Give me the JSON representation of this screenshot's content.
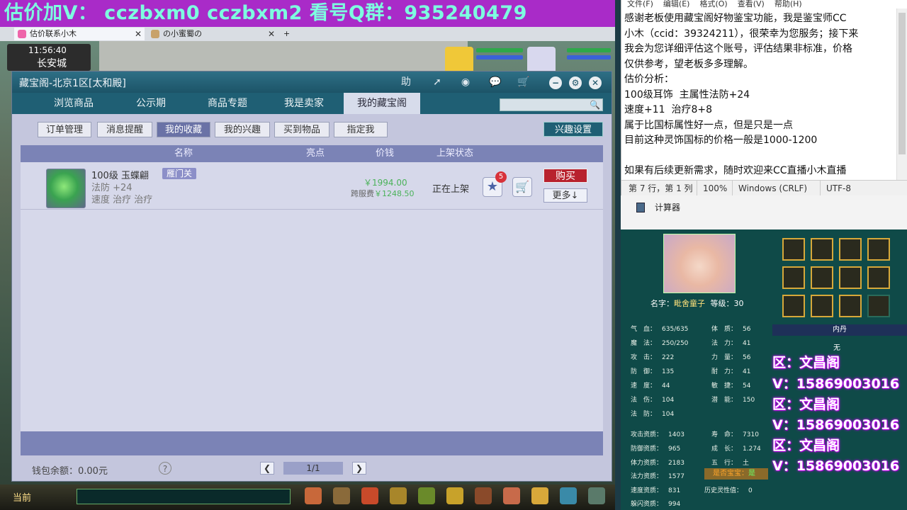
{
  "banner": {
    "text": "估价加V：  cczbxm0   cczbxm2   看号Q群：935240479"
  },
  "browser_tabs": [
    {
      "label": "估价联系小木"
    },
    {
      "label": "の小蜜蜀の"
    }
  ],
  "game": {
    "time": "11:56:40",
    "city": "长安城",
    "bottom_label": "当前"
  },
  "window": {
    "title": "藏宝阁-北京1区[太和殿]",
    "help_label": "助",
    "nav_tabs": [
      {
        "label": "浏览商品"
      },
      {
        "label": "公示期"
      },
      {
        "label": "商品专题"
      },
      {
        "label": "我是卖家"
      },
      {
        "label": "我的藏宝阁"
      }
    ],
    "search_placeholder": "",
    "sub_tabs": [
      {
        "label": "订单管理"
      },
      {
        "label": "消息提醒"
      },
      {
        "label": "我的收藏"
      },
      {
        "label": "我的兴趣"
      },
      {
        "label": "买到物品"
      },
      {
        "label": "指定我"
      }
    ],
    "interest_settings": "兴趣设置",
    "columns": {
      "name": "名称",
      "highlight": "亮点",
      "price": "价钱",
      "status": "上架状态"
    },
    "item": {
      "name": "100级 玉蝶翩",
      "tag": "雁门关",
      "stat1": "法防 +24",
      "stat2": "速度 治疗 治疗",
      "price": "￥1994.00",
      "fee_label": "跨服费",
      "fee": "￥1248.50",
      "status": "正在上架",
      "fav_count": "5",
      "buy": "购买",
      "more": "更多↓"
    },
    "wallet": "钱包余额：0.00元",
    "help": "?",
    "page": "1/1"
  },
  "notepad": {
    "menu": [
      "文件(F)",
      "编辑(E)",
      "格式(O)",
      "查看(V)",
      "帮助(H)"
    ],
    "text": "感谢老板使用藏宝阁好物鉴宝功能，我是鉴宝师CC\n小木（ccid：39324211），很荣幸为您服务；接下来\n我会为您详细评估这个账号，评估结果非标准，价格\n仅供参考，望老板多多理解。\n估价分析：\n100级耳饰  主属性法防+24\n速度+11  治疗8+8\n属于比国标属性好一点，但是只是一点\n目前这种灵饰国标的价格一般是1000-1200\n\n如果有后续更新需求，随时欢迎来CC直播小木直播",
    "status": {
      "pos": "第 7 行，第 1 列",
      "zoom": "100%",
      "eol": "Windows (CRLF)",
      "enc": "UTF-8"
    }
  },
  "calc": {
    "label": "计算器"
  },
  "character": {
    "name_label": "名字：",
    "name": "毗舍童子",
    "level_label": "等级：",
    "level": "30",
    "neidan_title": "内丹",
    "neidan_value": "无",
    "stats_left": [
      {
        "label": "气　血：",
        "value": "635/635"
      },
      {
        "label": "魔　法：",
        "value": "250/250"
      },
      {
        "label": "攻　击：",
        "value": "222"
      },
      {
        "label": "防　御：",
        "value": "135"
      },
      {
        "label": "速　度：",
        "value": "44"
      },
      {
        "label": "法　伤：",
        "value": "104"
      },
      {
        "label": "法　防：",
        "value": "104"
      }
    ],
    "stats_right": [
      {
        "label": "体　质：",
        "value": "56"
      },
      {
        "label": "法　力：",
        "value": "41"
      },
      {
        "label": "力　量：",
        "value": "56"
      },
      {
        "label": "耐　力：",
        "value": "41"
      },
      {
        "label": "敏　捷：",
        "value": "54"
      },
      {
        "label": "潜　能：",
        "value": "150"
      }
    ],
    "aptitude_left": [
      {
        "label": "攻击资质：",
        "value": "1403"
      },
      {
        "label": "防御资质：",
        "value": "965"
      },
      {
        "label": "体力资质：",
        "value": "2183"
      },
      {
        "label": "法力资质：",
        "value": "1577"
      },
      {
        "label": "速度资质：",
        "value": "831"
      },
      {
        "label": "躲闪资质：",
        "value": "994"
      }
    ],
    "aptitude_right": [
      {
        "label": "寿　命：",
        "value": "7310"
      },
      {
        "label": "成　长：",
        "value": "1.274"
      },
      {
        "label": "五　行：",
        "value": "土"
      }
    ],
    "baobao_label": "是否宝宝：",
    "baobao_value": "是",
    "history_label": "历史灵性值：",
    "history_value": "0"
  },
  "ads": [
    {
      "text": "区：文昌阁"
    },
    {
      "text": "V：15869003016"
    },
    {
      "text": "区：文昌阁"
    },
    {
      "text": "V：15869003016"
    },
    {
      "text": "区：文昌阁"
    },
    {
      "text": "V：15869003016"
    }
  ],
  "colors": {
    "accent": "#1f5f74",
    "buy": "#b8222e",
    "price": "#4bb25a",
    "banner": "#a92bc8"
  }
}
